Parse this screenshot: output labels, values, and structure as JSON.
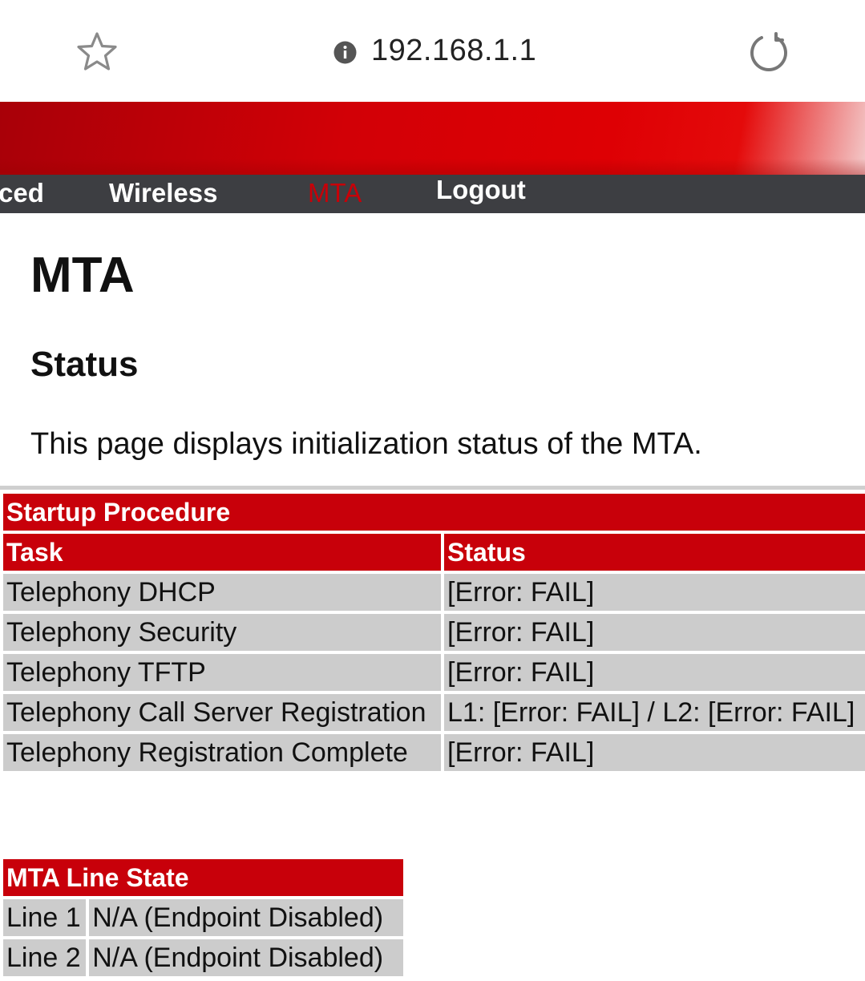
{
  "browser": {
    "url": "192.168.1.1",
    "icons": [
      "star-icon",
      "info-icon",
      "reload-icon"
    ]
  },
  "nav": {
    "items": [
      {
        "label": "ced"
      },
      {
        "label": "Wireless"
      },
      {
        "label": "MTA",
        "active": true
      },
      {
        "label": "Logout"
      }
    ]
  },
  "page": {
    "title": "MTA",
    "section": "Status",
    "description": "This page displays initialization status of the MTA."
  },
  "startup": {
    "title": "Startup Procedure",
    "headers": [
      "Task",
      "Status"
    ],
    "rows": [
      {
        "task": "Telephony DHCP",
        "status": "[Error: FAIL]"
      },
      {
        "task": "Telephony Security",
        "status": "[Error: FAIL]"
      },
      {
        "task": "Telephony TFTP",
        "status": "[Error: FAIL]"
      },
      {
        "task": "Telephony Call Server Registration",
        "status": "L1: [Error: FAIL] / L2: [Error: FAIL]"
      },
      {
        "task": "Telephony Registration Complete",
        "status": "[Error: FAIL]"
      }
    ]
  },
  "line_state": {
    "title": "MTA Line State",
    "rows": [
      {
        "line": "Line 1",
        "state": "N/A (Endpoint Disabled)"
      },
      {
        "line": "Line 2",
        "state": "N/A (Endpoint Disabled)"
      }
    ]
  },
  "colors": {
    "brand_red": "#c8000a",
    "nav_bg": "#3d3e42",
    "cell_bg": "#cccccc"
  }
}
